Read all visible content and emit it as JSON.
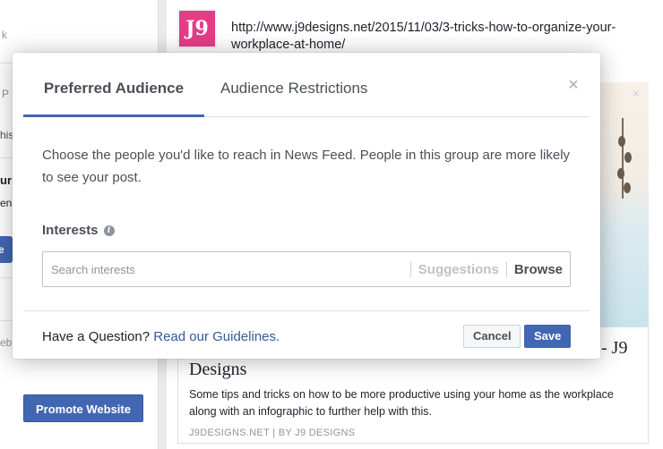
{
  "background": {
    "left_column": {
      "fragments": [
        "k",
        "P",
        "his",
        "ur",
        "en",
        "e P",
        "eb"
      ],
      "promote_button": "Promote Website"
    },
    "post": {
      "page_logo": "J9",
      "link_url": "http://www.j9designs.net/2015/11/03/3-tricks-how-to-organize-your-workplace-at-home/",
      "image_close": "×",
      "article": {
        "title_tail": "- J9",
        "title": "Designs",
        "description": "Some tips and tricks on how to be more productive using your home as the workplace along with an infographic to further help with this.",
        "source": "J9DESIGNS.NET | BY J9 DESIGNS"
      }
    }
  },
  "modal": {
    "tabs": [
      {
        "label": "Preferred Audience",
        "active": true
      },
      {
        "label": "Audience Restrictions",
        "active": false
      }
    ],
    "close_label": "×",
    "description": "Choose the people you'd like to reach in News Feed. People in this group are more likely to see your post.",
    "interests": {
      "label": "Interests",
      "info_icon": "i",
      "search_placeholder": "Search interests",
      "search_value": "",
      "suggestions_label": "Suggestions",
      "browse_label": "Browse"
    },
    "footer": {
      "question": "Have a Question?",
      "guidelines_link": "Read our Guidelines.",
      "cancel_label": "Cancel",
      "save_label": "Save"
    }
  },
  "colors": {
    "accent": "#4267b2",
    "link": "#365899",
    "page_logo_bg": "#e43d86"
  }
}
